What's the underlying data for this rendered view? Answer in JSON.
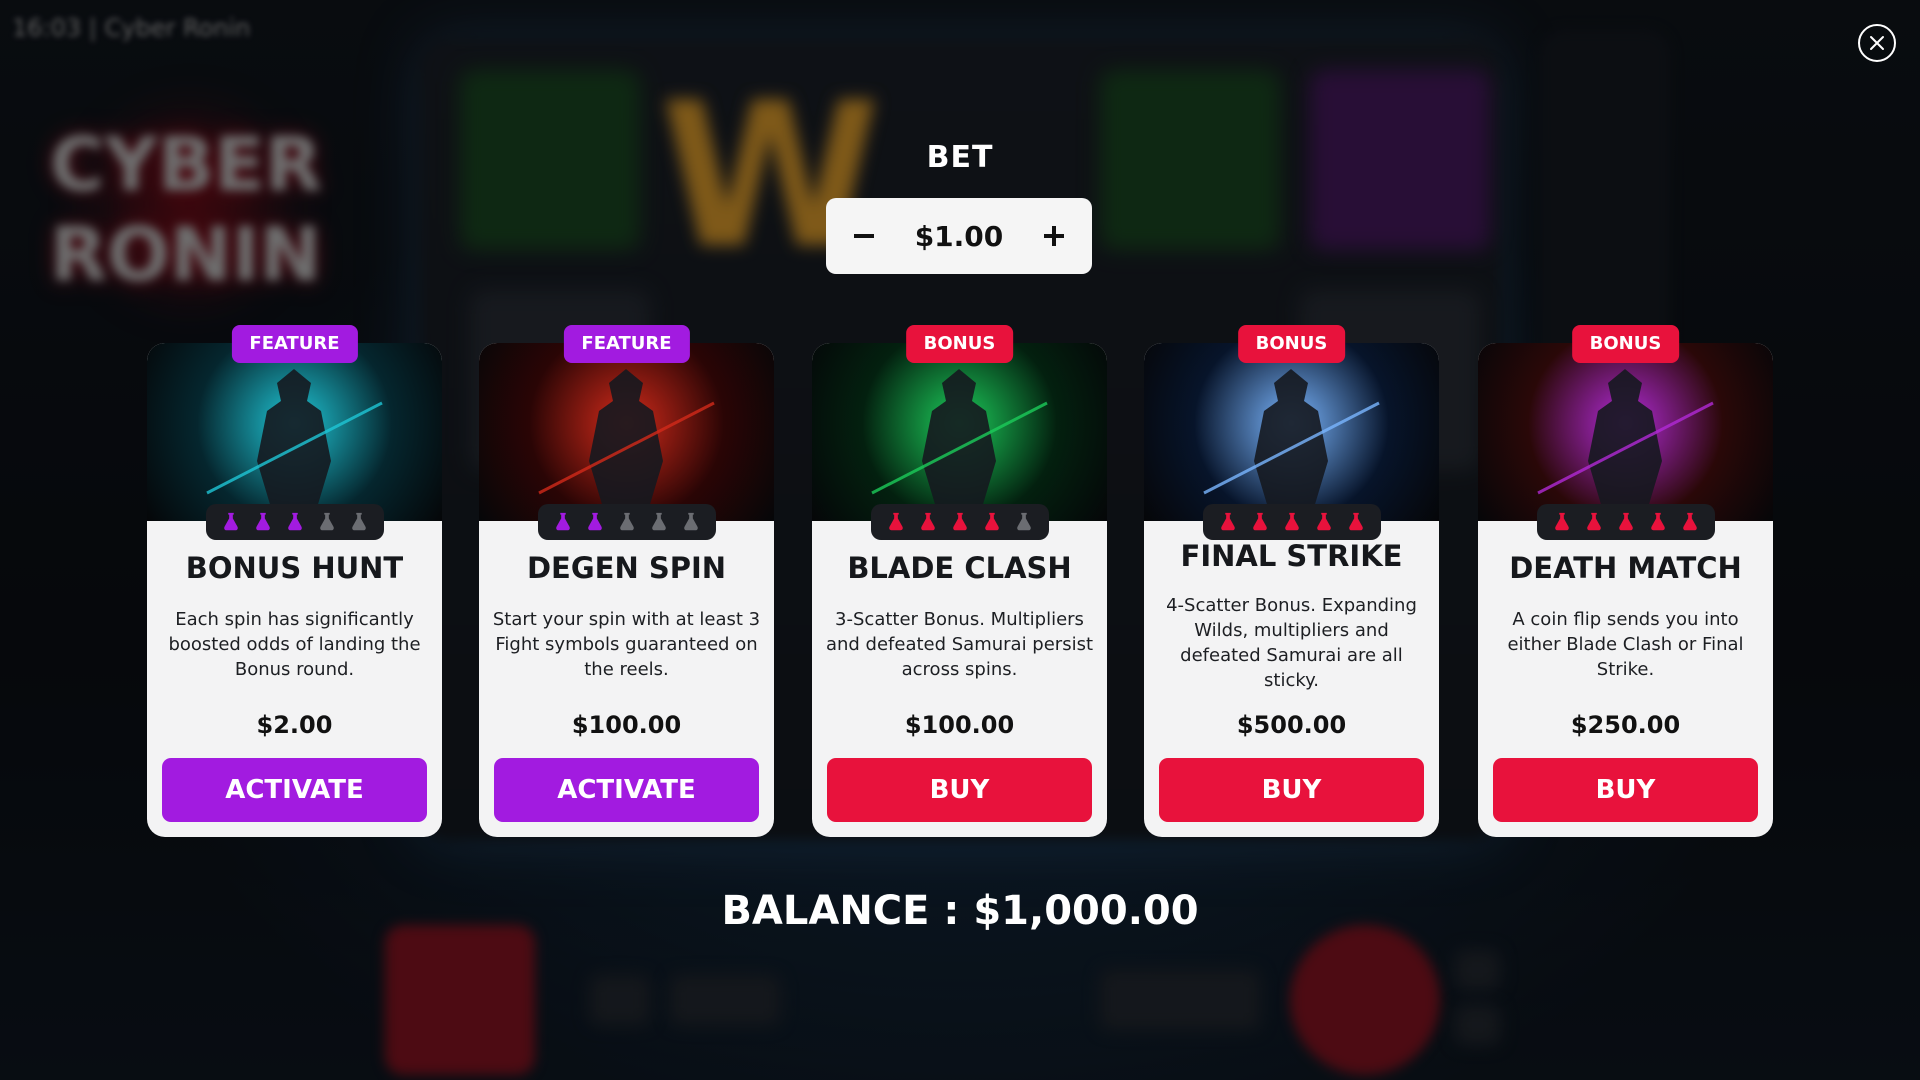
{
  "header": {
    "time_and_title": "16:03 | Cyber Ronin",
    "logo_text": [
      "CYBER",
      "RONIN"
    ]
  },
  "close_icon": "close-icon",
  "bet": {
    "title": "BET",
    "value": "$1.00",
    "minus_icon": "minus-icon",
    "plus_icon": "plus-icon"
  },
  "cards": [
    {
      "badge": "FEATURE",
      "badge_type": "feature",
      "title": "BONUS HUNT",
      "description": "Each spin has significantly boosted odds of landing the Bonus round.",
      "price": "$2.00",
      "button": "ACTIVATE",
      "button_type": "activate",
      "volatility_filled": 3,
      "volatility_total": 5,
      "volatility_color": "#a21be0",
      "art_colors": [
        "#05262e",
        "#1fc6d6"
      ]
    },
    {
      "badge": "FEATURE",
      "badge_type": "feature",
      "title": "DEGEN SPIN",
      "description": "Start your spin with at least 3 Fight symbols guaranteed on the reels.",
      "price": "$100.00",
      "button": "ACTIVATE",
      "button_type": "activate",
      "volatility_filled": 2,
      "volatility_total": 5,
      "volatility_color": "#a21be0",
      "art_colors": [
        "#2a0505",
        "#d22a1a"
      ]
    },
    {
      "badge": "BONUS",
      "badge_type": "bonus",
      "title": "BLADE CLASH",
      "description": "3-Scatter Bonus. Multipliers and defeated Samurai persist across spins.",
      "price": "$100.00",
      "button": "BUY",
      "button_type": "buy",
      "volatility_filled": 4,
      "volatility_total": 5,
      "volatility_color": "#e8123c",
      "art_colors": [
        "#03200f",
        "#1ccc5a"
      ]
    },
    {
      "badge": "BONUS",
      "badge_type": "bonus",
      "title": "FINAL STRIKE",
      "description": "4-Scatter Bonus. Expanding Wilds, multipliers and defeated Samurai are all sticky.",
      "price": "$500.00",
      "button": "BUY",
      "button_type": "buy",
      "volatility_filled": 5,
      "volatility_total": 5,
      "volatility_color": "#e8123c",
      "art_colors": [
        "#07142a",
        "#7ab6ff"
      ]
    },
    {
      "badge": "BONUS",
      "badge_type": "bonus",
      "title": "DEATH MATCH",
      "description": "A coin flip sends you into either Blade Clash or Final Strike.",
      "price": "$250.00",
      "button": "BUY",
      "button_type": "buy",
      "volatility_filled": 5,
      "volatility_total": 5,
      "volatility_color": "#e8123c",
      "art_colors": [
        "#2a0808",
        "#b12ad6"
      ]
    }
  ],
  "balance": {
    "label": "BALANCE : $1,000.00"
  }
}
